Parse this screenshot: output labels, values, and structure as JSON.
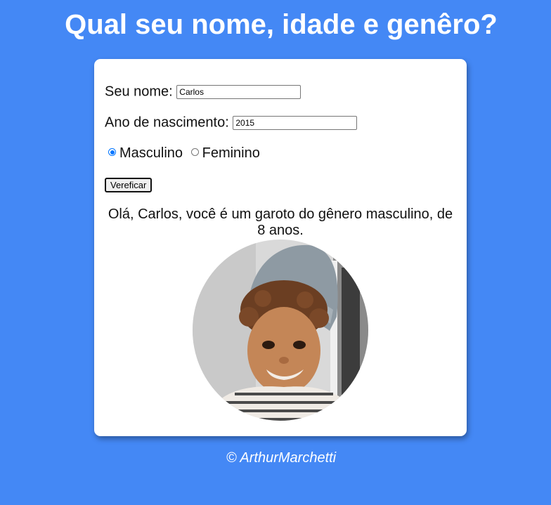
{
  "header": {
    "title": "Qual seu nome, idade e genêro?"
  },
  "form": {
    "name_label": "Seu nome:",
    "name_value": "Carlos",
    "birth_label": "Ano de nascimento:",
    "birth_value": "2015",
    "gender_options": [
      {
        "label": "Masculino",
        "checked": true
      },
      {
        "label": "Feminino",
        "checked": false
      }
    ],
    "verify_label": "Vereficar"
  },
  "result": {
    "line1": "Olá, Carlos, você é um garoto do gênero masculino, de",
    "line2": "8 anos.",
    "photo_icon": "child-photo-icon"
  },
  "footer": {
    "text": "© ArthurMarchetti"
  },
  "colors": {
    "background": "#4488f5",
    "card": "#ffffff",
    "radio_accent": "#0075ff"
  }
}
